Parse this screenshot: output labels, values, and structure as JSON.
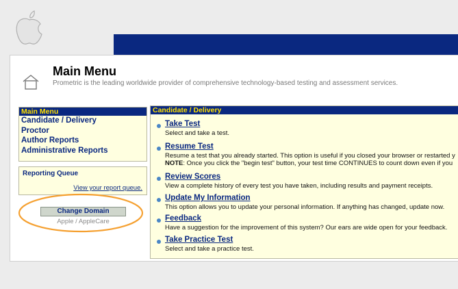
{
  "header": {
    "title": "Main Menu",
    "subtitle": "Prometric is the leading worldwide provider of comprehensive technology-based testing and assessment services."
  },
  "left_menu": {
    "header": "Main Menu",
    "items": [
      {
        "label": "Candidate / Delivery"
      },
      {
        "label": "Proctor"
      },
      {
        "label": "Author Reports"
      },
      {
        "label": "Administrative Reports"
      }
    ]
  },
  "reporting_queue": {
    "title": "Reporting Queue",
    "link": "View your report queue."
  },
  "domain": {
    "button_label": "Change Domain",
    "current_value": "Apple / AppleCare"
  },
  "right_panel": {
    "header": "Candidate / Delivery",
    "options": [
      {
        "title": "Take Test",
        "description": "Select and take a test."
      },
      {
        "title": "Resume Test",
        "description": "Resume a test that you already started. This option is useful if you closed your browser or restarted y",
        "note_label": "NOTE",
        "note_text": ": Once you click the \"begin test\" button, your test time CONTINUES to count down even if you"
      },
      {
        "title": "Review Scores",
        "description": "View a complete history of every test you have taken, including results and payment receipts."
      },
      {
        "title": "Update My Information",
        "description": "This option allows you to update your personal information. If anything has changed, update now."
      },
      {
        "title": "Feedback",
        "description": "Have a suggestion for the improvement of this system? Our ears are wide open for your feedback."
      },
      {
        "title": "Take Practice Test",
        "description": "Select and take a practice test."
      }
    ]
  },
  "colors": {
    "navy": "#0a2880",
    "menu_header_text": "#ffe100",
    "panel_bg": "#ffffe0",
    "annotation_circle": "#f5a030"
  },
  "icons": [
    "apple-logo",
    "home-icon",
    "bullet-icon"
  ]
}
